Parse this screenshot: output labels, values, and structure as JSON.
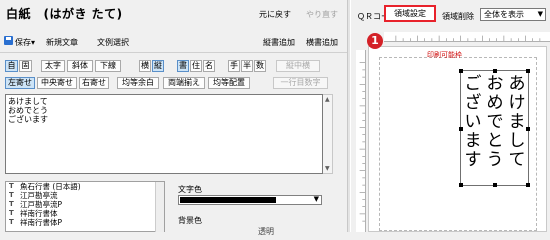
{
  "header": {
    "title": "白紙　(はがき たて)",
    "undo": "元に戻す",
    "redo": "やり直す"
  },
  "toolbar": {
    "save": "保存",
    "new_text": "新規文章",
    "select_text": "文例選択",
    "add_vertical": "縦書追加",
    "add_horizontal": "横書追加"
  },
  "format_row1": [
    "自",
    "固",
    "太字",
    "斜体",
    "下線",
    "横",
    "縦",
    "書",
    "住",
    "名",
    "手",
    "半",
    "数",
    "縦中横"
  ],
  "format_row2": [
    "左寄せ",
    "中央寄せ",
    "右寄せ",
    "均等余白",
    "両端揃え",
    "均等配置",
    "一行目数字"
  ],
  "text": {
    "lines": [
      "あけまして",
      "おめでとう",
      "ございます"
    ]
  },
  "fonts": [
    "魚石行書 (日本語)",
    "江戸勘亭流",
    "江戸勘亭流P",
    "祥南行書体",
    "祥南行書体P"
  ],
  "labels": {
    "text_color": "文字色",
    "background_color": "背景色",
    "transparent": "透明"
  },
  "right": {
    "qr": "ＱＲコード",
    "region_set": "領域設定",
    "region_delete": "領域削除",
    "display_select": "全体を表示",
    "step_badge": "1",
    "print_area": "印刷可能枠"
  },
  "preview": {
    "columns": [
      "あけまして",
      "おめでとう",
      "ございます"
    ]
  }
}
